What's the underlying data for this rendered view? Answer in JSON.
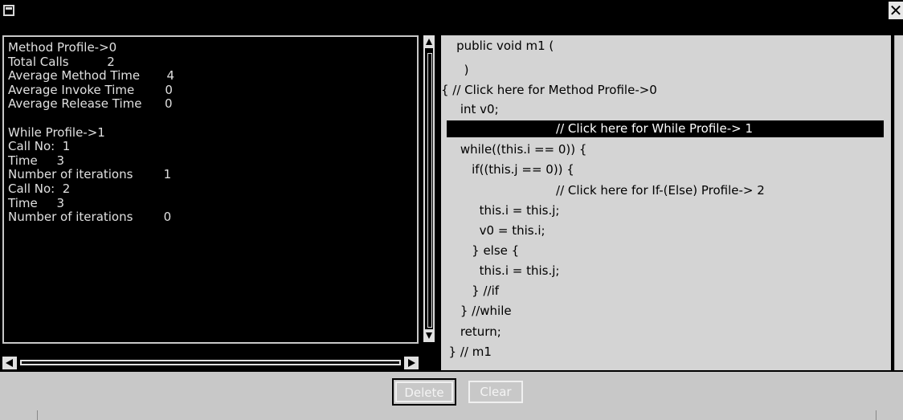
{
  "window": {
    "close_glyph": "✕"
  },
  "profile_panel": {
    "lines": [
      "Method Profile->0",
      "Total Calls          2",
      "Average Method Time       4",
      "Average Invoke Time        0",
      "Average Release Time      0",
      "",
      "While Profile->1",
      "Call No:  1",
      "Time     3",
      "Number of iterations        1",
      "Call No:  2",
      "Time     3",
      "Number of iterations        0"
    ]
  },
  "code_panel": {
    "lines": [
      "    public void m1 (",
      "      )",
      "{ // Click here for Method Profile->0",
      "     int v0;",
      "                              // Click here for While Profile-> 1",
      "     while((this.i == 0)) {",
      "        if((this.j == 0)) {",
      "                              // Click here for If-(Else) Profile-> 2",
      "          this.i = this.j;",
      "          v0 = this.i;",
      "        } else {",
      "          this.i = this.j;",
      "        } //if",
      "     } //while",
      "     return;",
      "  } // m1"
    ],
    "highlighted_line": 4
  },
  "buttons": {
    "delete": "Delete",
    "clear": "Clear"
  }
}
